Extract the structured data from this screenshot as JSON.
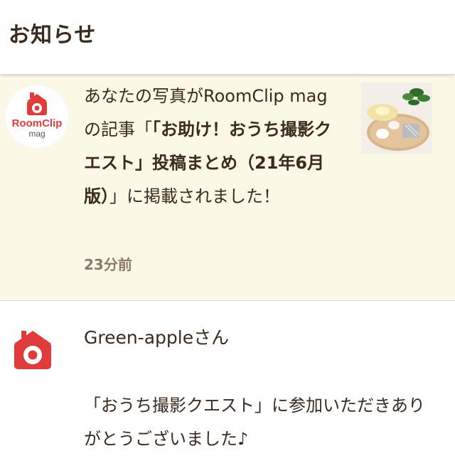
{
  "header": {
    "title": "お知らせ"
  },
  "notifications": [
    {
      "avatar_label": "RoomClip",
      "avatar_sub": "mag",
      "message_prefix": "あなたの写真がRoomClip magの記事「",
      "message_bold": "「お助け！おうち撮影クエスト」投稿まとめ（21年6月版）",
      "message_suffix": "」に掲載されました！",
      "time": "23分前",
      "thumbnail_icon": "kitchen-photo-thumbnail"
    },
    {
      "avatar_icon": "roomclip-camera-icon",
      "user": "Green-appleさん",
      "message": "「おうち撮影クエスト」に参加いただきありがとうございました♪"
    }
  ],
  "colors": {
    "brand_red": "#e03c3c",
    "unread_bg": "#fbf8e8",
    "text": "#3b2a1e",
    "time_text": "#8c7a66"
  }
}
